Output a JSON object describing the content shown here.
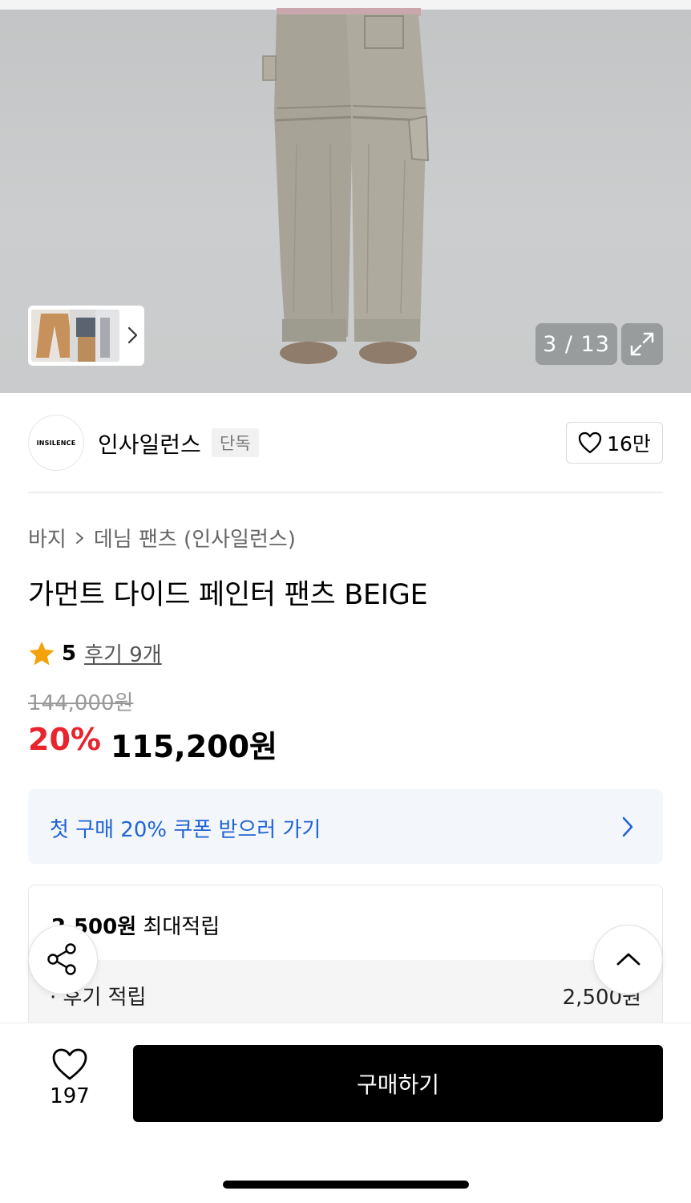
{
  "gallery": {
    "counter": "3 / 13",
    "thumbnails": [
      "thumbnail-pants-flat",
      "thumbnail-model-full",
      "thumbnail-model-side"
    ]
  },
  "brand": {
    "logo_text": "INSILENCE",
    "name": "인사일런스",
    "badge": "단독",
    "like_count": "16만"
  },
  "breadcrumb": {
    "category": "바지",
    "separator": ">",
    "subcategory": "데님 팬츠 (인사일런스)"
  },
  "product": {
    "title": "가먼트 다이드 페인터 팬츠 BEIGE",
    "rating": "5",
    "reviews": "후기 9개",
    "original_price": "144,000원",
    "discount": "20%",
    "sale_price": "115,200원"
  },
  "coupon": {
    "label": "첫 구매 20% 쿠폰 받으러 가기"
  },
  "points": {
    "amount": "2,500원",
    "suffix": " 최대적립",
    "row_label": "· 후기 적립",
    "row_value": "2,500원"
  },
  "bottom": {
    "wish_count": "197",
    "buy_label": "구매하기"
  },
  "colors": {
    "discount_red": "#e8242c",
    "coupon_blue": "#1f63d6",
    "star": "#f5a20a",
    "buy_button": "#000000"
  },
  "icons": [
    "chevron-right-icon",
    "expand-icon",
    "heart-icon",
    "star-icon",
    "share-icon",
    "chevron-up-icon"
  ]
}
